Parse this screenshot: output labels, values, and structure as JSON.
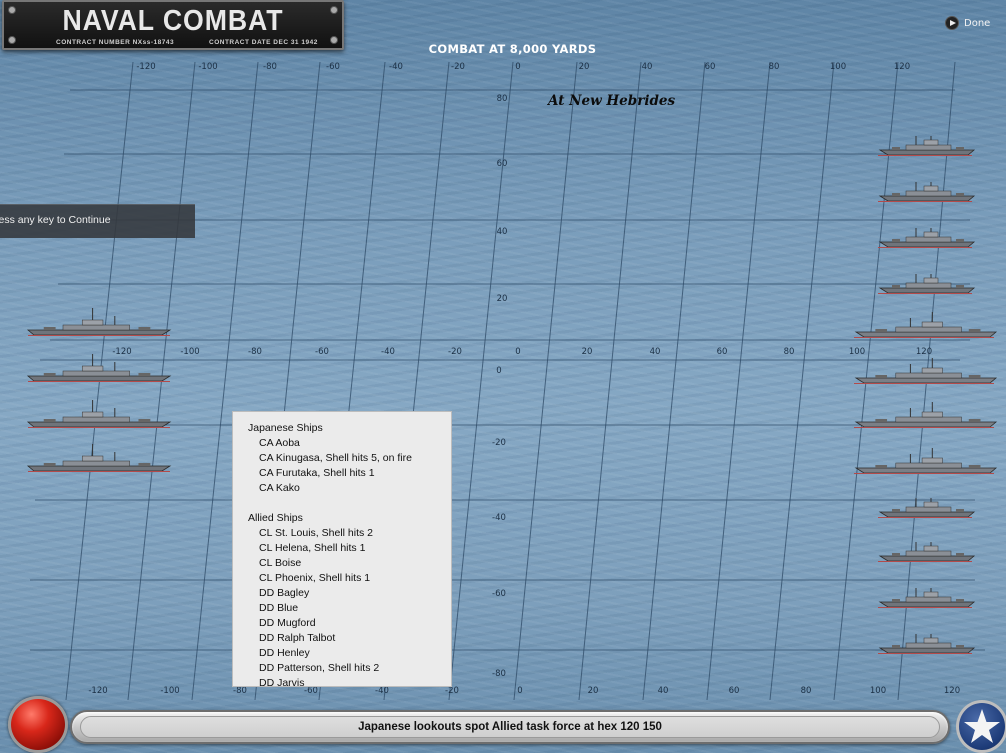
{
  "logo": {
    "title": "NAVAL COMBAT",
    "contract_number": "CONTRACT NUMBER   NXss-18743",
    "contract_date": "CONTRACT DATE  DEC  31  1942"
  },
  "done": {
    "label": "Done",
    "icon": "play-circle-icon"
  },
  "combat_title": "COMBAT AT 8,000 YARDS",
  "location": "At New Hebrides",
  "continue_prompt": "Press any key to Continue",
  "grid": {
    "upper_x_ticks": [
      "-120",
      "-100",
      "-80",
      "-60",
      "-40",
      "-20",
      "0",
      "20",
      "40",
      "60",
      "80",
      "100",
      "120"
    ],
    "lower_x_ticks": [
      "-120",
      "-100",
      "-80",
      "-60",
      "-40",
      "-20",
      "0",
      "20",
      "40",
      "60",
      "80",
      "100",
      "120"
    ],
    "bottom_x_ticks": [
      "-120",
      "-100",
      "-80",
      "-60",
      "-40",
      "-20",
      "0",
      "20",
      "40",
      "60",
      "80",
      "100",
      "120"
    ],
    "upper_y_ticks": [
      "80",
      "60",
      "40",
      "20"
    ],
    "lower_y_ticks": [
      "0",
      "-20",
      "-40",
      "-60",
      "-80"
    ]
  },
  "ship_list": {
    "japanese_header": "Japanese Ships",
    "japanese": [
      "CA Aoba",
      "CA Kinugasa, Shell hits 5,  on fire",
      "CA Furutaka, Shell hits 1",
      "CA Kako"
    ],
    "allied_header": "Allied Ships",
    "allied": [
      "CL St. Louis, Shell hits 2",
      "CL Helena, Shell hits 1",
      "CL Boise",
      "CL Phoenix, Shell hits 1",
      "DD Bagley",
      "DD Blue",
      "DD Mugford",
      "DD Ralph Talbot",
      "DD Henley",
      "DD Patterson, Shell hits 2",
      "DD Jarvis"
    ]
  },
  "status": {
    "message": "Japanese lookouts spot Allied task force at hex 120 150"
  },
  "colors": {
    "sea": "#7d9fbc",
    "grid_line": "#2e4a66",
    "panel_bg": "#ebebeb"
  },
  "icons": {
    "red_button": "red-circle-button-icon",
    "star_button": "star-roundel-icon"
  }
}
